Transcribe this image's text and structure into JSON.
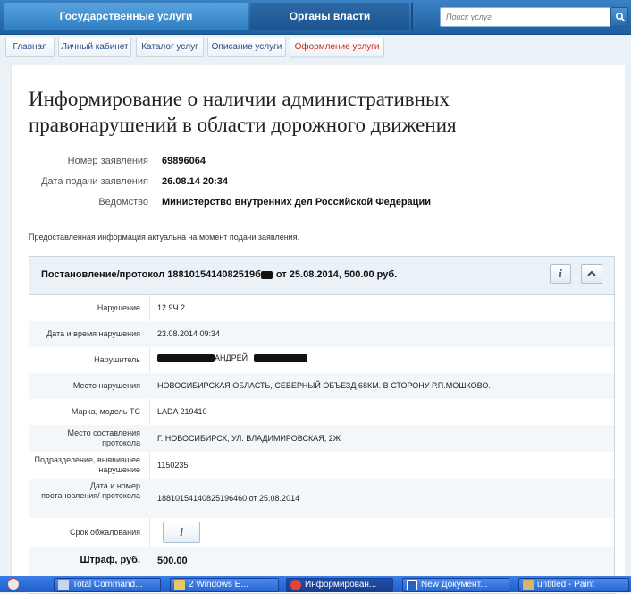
{
  "topnav": {
    "gov_services": "Государственные услуги",
    "authorities": "Органы власти",
    "search_placeholder": "Поиск услуг"
  },
  "breadcrumb": [
    "Главная",
    "Личный кабинет",
    "Каталог услуг",
    "Описание услуги",
    "Оформление услуги"
  ],
  "page": {
    "title": "Информирование о наличии административных правонарушений в области дорожного движения",
    "meta": [
      {
        "label": "Номер заявления",
        "value": "69896064"
      },
      {
        "label": "Дата подачи заявления",
        "value": "26.08.14 20:34"
      },
      {
        "label": "Ведомство",
        "value": "Министерство внутренних дел Российской Федерации"
      }
    ],
    "note": "Предоставленная информация актуальна на момент подачи заявления."
  },
  "panel": {
    "title_number": "Постановление/протокол 1881015414082519б",
    "title_rest": "от 25.08.2014, 500.00 руб.",
    "rows": [
      {
        "label": "Нарушение",
        "value": "12.9Ч.2"
      },
      {
        "label": "Дата и время нарушения",
        "value": "23.08.2014 09:34"
      },
      {
        "label": "Нарушитель",
        "value": "АНДРЕЙ"
      },
      {
        "label": "Место нарушения",
        "value": "НОВОСИБИРСКАЯ ОБЛАСТЬ, СЕВЕРНЫЙ ОБЪЕЗД 68КМ. В СТОРОНУ Р.П.МОШКОВО."
      },
      {
        "label": "Марка, модель ТС",
        "value": "LADA 219410"
      },
      {
        "label": "Место составления протокола",
        "value": "Г. НОВОСИБИРСК, УЛ. ВЛАДИМИРОВСКАЯ, 2Ж"
      },
      {
        "label": "Подразделение, выявившее нарушение",
        "value": "1150235"
      },
      {
        "label": "Дата и номер постановления/ протокола",
        "value": "18810154140825196460 от 25.08.2014"
      },
      {
        "label": "Срок обжалования",
        "value": ""
      },
      {
        "label": "Штраф, руб.",
        "value": "500.00"
      }
    ]
  },
  "taskbar": [
    {
      "label": "Total Command..."
    },
    {
      "label": "2 Windows E..."
    },
    {
      "label": "Информирован..."
    },
    {
      "label": "New Документ..."
    },
    {
      "label": "untitled - Paint"
    }
  ]
}
